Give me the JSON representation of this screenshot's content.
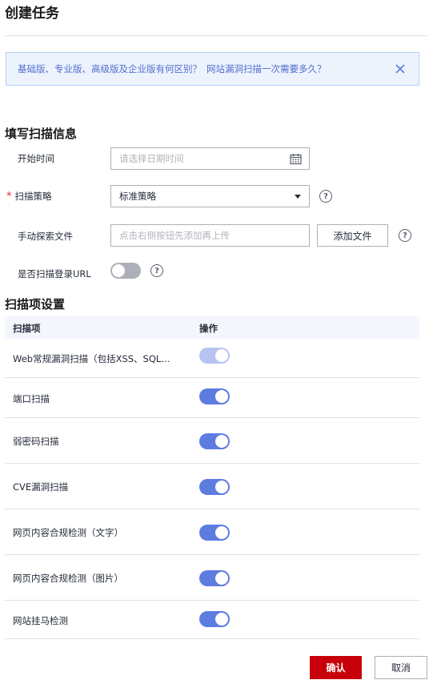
{
  "dialog": {
    "title": "创建任务"
  },
  "notice": {
    "link1": "基础版、专业版、高级版及企业版有何区别？",
    "link2": "网站漏洞扫描一次需要多久？"
  },
  "scan_info": {
    "section_title": "填写扫描信息",
    "start_time": {
      "label": "开始时间",
      "placeholder": "请选择日期时间"
    },
    "strategy": {
      "label": "扫描策略",
      "required_mark": "*",
      "value": "标准策略"
    },
    "manual_file": {
      "label": "手动探索文件",
      "placeholder": "点击右侧按钮先添加再上传",
      "add_button": "添加文件"
    },
    "scan_login_url": {
      "label": "是否扫描登录URL",
      "enabled": false
    }
  },
  "scan_items": {
    "section_title": "扫描项设置",
    "columns": [
      "扫描项",
      "操作"
    ],
    "rows": [
      {
        "name": "Web常规漏洞扫描（包括XSS、SQL…",
        "enabled": true,
        "disabled": true
      },
      {
        "name": "端口扫描",
        "enabled": true,
        "disabled": false
      },
      {
        "name": "弱密码扫描",
        "enabled": true,
        "disabled": false
      },
      {
        "name": "CVE漏洞扫描",
        "enabled": true,
        "disabled": false
      },
      {
        "name": "网页内容合规检测（文字）",
        "enabled": true,
        "disabled": false
      },
      {
        "name": "网页内容合规检测（图片）",
        "enabled": true,
        "disabled": false
      },
      {
        "name": "网站挂马检测",
        "enabled": true,
        "disabled": false
      }
    ]
  },
  "footer": {
    "confirm": "确认",
    "cancel": "取消"
  },
  "colors": {
    "primary_red": "#c7000b",
    "toggle_on": "#5e7ce0",
    "toggle_disabled": "#b7c4f1",
    "toggle_off": "#adb0b8",
    "link_blue": "#526ecc",
    "notice_bg": "#edf3fd"
  },
  "icons": {
    "close": "close-icon",
    "calendar": "calendar-icon",
    "help": "help-icon",
    "dropdown": "chevron-down-icon"
  }
}
